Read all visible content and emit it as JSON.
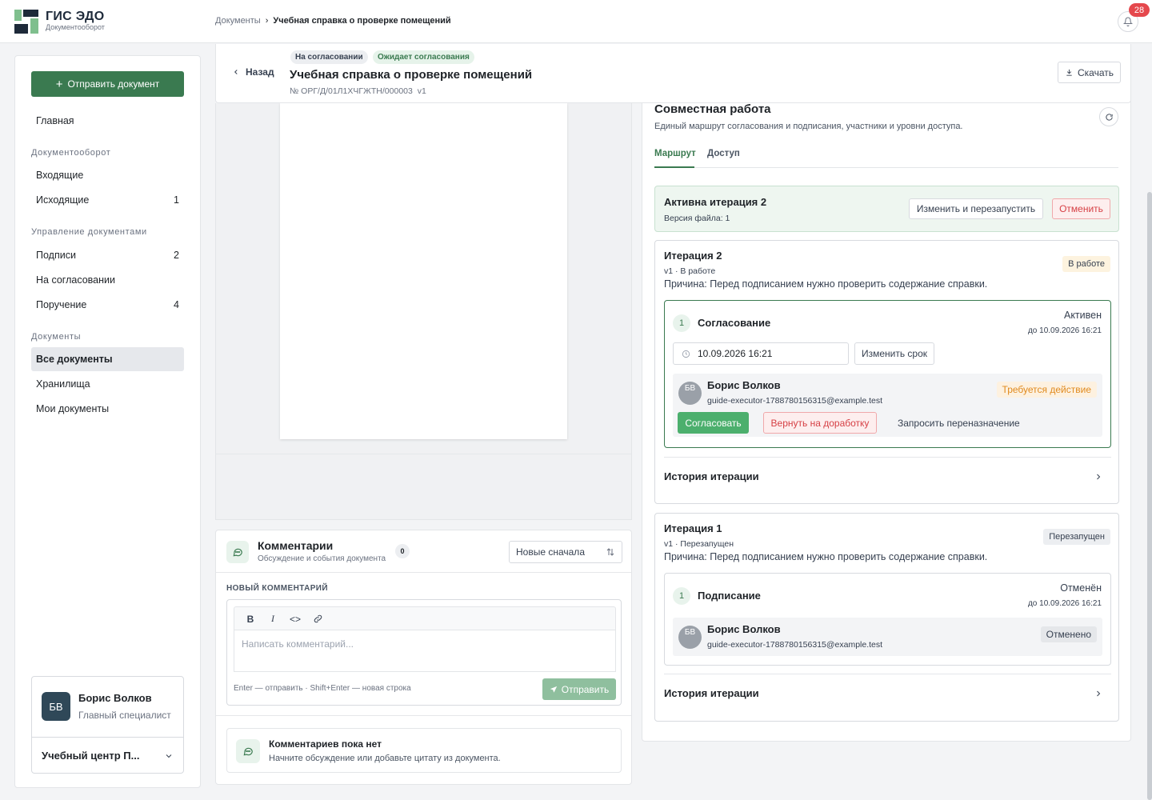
{
  "colors": {
    "brand_green": "#3a7a50",
    "brand_dark": "#1e2a3a",
    "danger": "#d64045",
    "warning": "#e08a1e",
    "badge_red": "#e5484d"
  },
  "app": {
    "title": "ГИС ЭДО",
    "subtitle": "Документооборот"
  },
  "breadcrumbs": {
    "root": "Документы",
    "separator": "›",
    "current": "Учебная справка о проверке помещений"
  },
  "notifications": {
    "count": "28",
    "icon": "bell-icon"
  },
  "sidebar": {
    "send_label": "Отправить документ",
    "home": "Главная",
    "sections": {
      "workflow": "Документооборот",
      "management": "Управление документами",
      "documents": "Документы"
    },
    "items": [
      {
        "label": "Входящие",
        "count": ""
      },
      {
        "label": "Исходящие",
        "count": "1"
      },
      {
        "label": "Подписи",
        "count": "2"
      },
      {
        "label": "На согласовании",
        "count": ""
      },
      {
        "label": "Поручение",
        "count": "4"
      },
      {
        "label": "Все документы",
        "count": ""
      },
      {
        "label": "Хранилища",
        "count": ""
      },
      {
        "label": "Мои документы",
        "count": ""
      }
    ],
    "user": {
      "initials": "БВ",
      "name": "Борис Волков",
      "role": "Главный специалист"
    },
    "org": "Учебный центр П..."
  },
  "document": {
    "back": "Назад",
    "badges": [
      "На согласовании",
      "Ожидает согласования"
    ],
    "title": "Учебная справка о проверке помещений",
    "number": "№ ОРГ/Д/01Л1ХЧГЖТН/000003",
    "version": "v1",
    "download": "Скачать"
  },
  "comments": {
    "title": "Комментарии",
    "subtitle": "Обсуждение и события документа",
    "count": "0",
    "sort": "Новые сначала",
    "new_label": "НОВЫЙ КОММЕНТАРИЙ",
    "toolbar": {
      "bold": "B",
      "italic": "I",
      "code": "<>"
    },
    "placeholder": "Написать комментарий...",
    "hint": "Enter — отправить · Shift+Enter — новая строка",
    "send": "Отправить",
    "empty_title": "Комментариев пока нет",
    "empty_sub": "Начните обсуждение или добавьте цитату из документа."
  },
  "collab": {
    "title": "Совместная работа",
    "subtitle": "Единый маршрут согласования и подписания, участники и уровни доступа.",
    "tabs": [
      "Маршрут",
      "Доступ"
    ],
    "active_iteration": {
      "title": "Активна итерация 2",
      "file_version": "Версия файла: 1",
      "restart": "Изменить и перезапустить",
      "cancel": "Отменить"
    },
    "iterations": [
      {
        "title": "Итерация 2",
        "meta": "v1 · В работе",
        "status": "В работе",
        "reason": "Причина: Перед подписанием нужно проверить содержание справки.",
        "stage": {
          "num": "1",
          "name": "Согласование",
          "state": "Активен",
          "due": "до 10.09.2026 16:21",
          "deadline_value": "10.09.2026 16:21",
          "change_deadline": "Изменить срок"
        },
        "participant": {
          "initials": "БВ",
          "name": "Борис Волков",
          "email": "guide-executor-1788780156315@example.test",
          "status": "Требуется действие"
        },
        "actions": {
          "approve": "Согласовать",
          "return": "Вернуть на доработку",
          "reassign": "Запросить переназначение"
        },
        "history": "История итерации"
      },
      {
        "title": "Итерация 1",
        "meta": "v1 · Перезапущен",
        "status": "Перезапущен",
        "reason": "Причина: Перед подписанием нужно проверить содержание справки.",
        "stage": {
          "num": "1",
          "name": "Подписание",
          "state": "Отменён",
          "due": "до 10.09.2026 16:21"
        },
        "participant": {
          "initials": "БВ",
          "name": "Борис Волков",
          "email": "guide-executor-1788780156315@example.test",
          "status": "Отменено"
        },
        "history": "История итерации"
      }
    ]
  }
}
